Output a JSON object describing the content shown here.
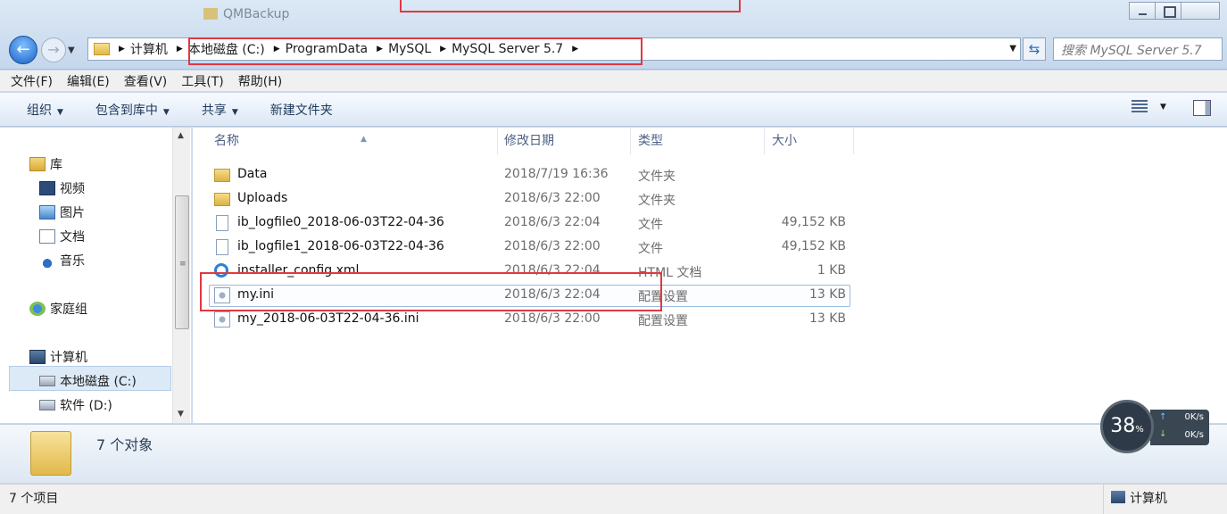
{
  "window": {
    "bg_ghost_text": "QMBackup"
  },
  "address": {
    "crumbs": [
      "计算机",
      "本地磁盘 (C:)",
      "ProgramData",
      "MySQL",
      "MySQL Server 5.7"
    ],
    "search_placeholder": "搜索 MySQL Server 5.7"
  },
  "menu": [
    "文件(F)",
    "编辑(E)",
    "查看(V)",
    "工具(T)",
    "帮助(H)"
  ],
  "commands": [
    "组织",
    "包含到库中",
    "共享",
    "新建文件夹"
  ],
  "nav": {
    "library": "库",
    "videos": "视频",
    "pictures": "图片",
    "documents": "文档",
    "music": "音乐",
    "homegroup": "家庭组",
    "computer": "计算机",
    "disk_c": "本地磁盘 (C:)",
    "disk_d": "软件 (D:)"
  },
  "columns": [
    "名称",
    "修改日期",
    "类型",
    "大小"
  ],
  "files": [
    {
      "name": "Data",
      "date": "2018/7/19 16:36",
      "type": "文件夹",
      "size": "",
      "icon": "folder-icon"
    },
    {
      "name": "Uploads",
      "date": "2018/6/3 22:00",
      "type": "文件夹",
      "size": "",
      "icon": "folder-icon"
    },
    {
      "name": "ib_logfile0_2018-06-03T22-04-36",
      "date": "2018/6/3 22:04",
      "type": "文件",
      "size": "49,152 KB",
      "icon": "file-icon"
    },
    {
      "name": "ib_logfile1_2018-06-03T22-04-36",
      "date": "2018/6/3 22:00",
      "type": "文件",
      "size": "49,152 KB",
      "icon": "file-icon"
    },
    {
      "name": "installer_config.xml",
      "date": "2018/6/3 22:04",
      "type": "HTML 文档",
      "size": "1 KB",
      "icon": "ie-icon"
    },
    {
      "name": "my.ini",
      "date": "2018/6/3 22:04",
      "type": "配置设置",
      "size": "13 KB",
      "icon": "config-file-icon"
    },
    {
      "name": "my_2018-06-03T22-04-36.ini",
      "date": "2018/6/3 22:00",
      "type": "配置设置",
      "size": "13 KB",
      "icon": "config-file-icon"
    }
  ],
  "details": {
    "object_count": "7 个对象"
  },
  "widget": {
    "percent": "38",
    "percent_sign": "%",
    "up_rate": "0K/s",
    "down_rate": "0K/s"
  },
  "status": {
    "items": "7 个项目",
    "location": "计算机"
  },
  "colors": {
    "highlight_red": "#e0393e",
    "selection_blue": "#dceaf8"
  }
}
